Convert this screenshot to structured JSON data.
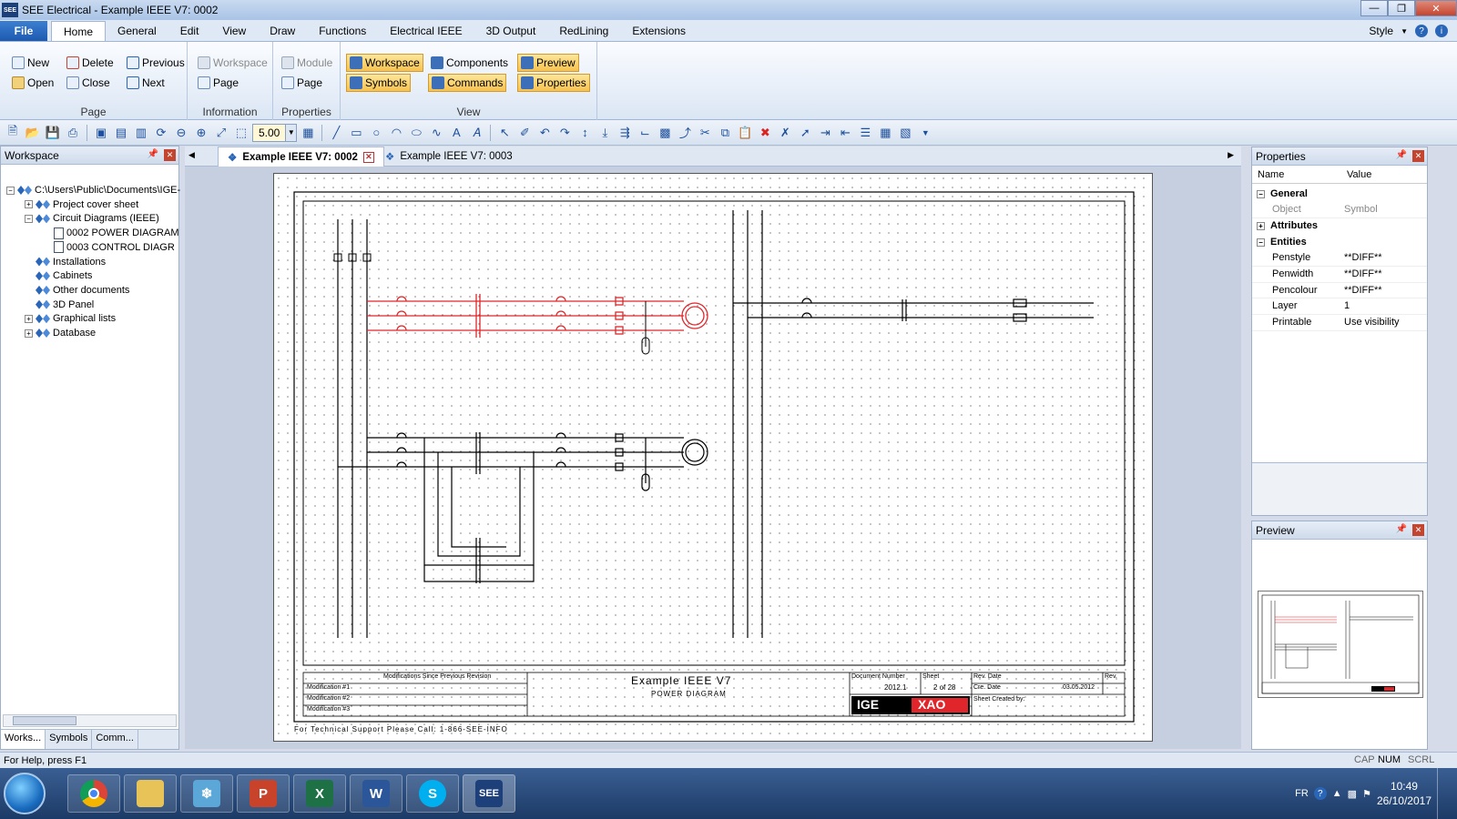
{
  "window": {
    "title": "SEE Electrical - Example IEEE V7: 0002",
    "app_icon": "SEE"
  },
  "menu": {
    "file": "File",
    "tabs": [
      "Home",
      "General",
      "Edit",
      "View",
      "Draw",
      "Functions",
      "Electrical IEEE",
      "3D Output",
      "RedLining",
      "Extensions"
    ],
    "active_tab": "Home",
    "style_label": "Style"
  },
  "ribbon": {
    "groups": {
      "page": {
        "label": "Page",
        "new": "New",
        "open": "Open",
        "delete": "Delete",
        "close": "Close",
        "previous": "Previous",
        "next": "Next"
      },
      "information": {
        "label": "Information",
        "workspace": "Workspace",
        "page": "Page"
      },
      "properties": {
        "label": "Properties",
        "module": "Module",
        "page": "Page"
      },
      "view": {
        "label": "View",
        "workspace": "Workspace",
        "symbols": "Symbols",
        "components": "Components",
        "commands": "Commands",
        "preview": "Preview",
        "properties": "Properties"
      }
    }
  },
  "toolbar": {
    "zoom_value": "5.00"
  },
  "workspace": {
    "title": "Workspace",
    "tree": [
      {
        "label": "C:\\Users\\Public\\Documents\\IGE-",
        "level": 0,
        "expander": "−"
      },
      {
        "label": "Project cover sheet",
        "level": 1,
        "expander": "+"
      },
      {
        "label": "Circuit Diagrams (IEEE)",
        "level": 1,
        "expander": "−"
      },
      {
        "label": "0002 POWER DIAGRAM",
        "level": 2,
        "expander": ""
      },
      {
        "label": "0003 CONTROL DIAGR",
        "level": 2,
        "expander": ""
      },
      {
        "label": "Installations",
        "level": 1,
        "expander": ""
      },
      {
        "label": "Cabinets",
        "level": 1,
        "expander": ""
      },
      {
        "label": "Other documents",
        "level": 1,
        "expander": ""
      },
      {
        "label": "3D Panel",
        "level": 1,
        "expander": ""
      },
      {
        "label": "Graphical lists",
        "level": 1,
        "expander": "+"
      },
      {
        "label": "Database",
        "level": 1,
        "expander": "+"
      }
    ],
    "bottom_tabs": [
      "Works...",
      "Symbols",
      "Comm..."
    ]
  },
  "doc_tabs": [
    {
      "label": "Example IEEE V7: 0002",
      "active": true
    },
    {
      "label": "Example IEEE V7: 0003",
      "active": false
    }
  ],
  "drawing": {
    "title": "Example IEEE V7",
    "subtitle": "POWER DIAGRAM",
    "doc_number_label": "Document Number",
    "doc_number": "2012.1",
    "sheet_label": "Sheet",
    "sheet": "2 of 28",
    "rev_date_label": "Rev. Date",
    "cre_date_label": "Cre. Date",
    "cre_date": "03.05.2012",
    "created_by": "Sheet Created by:",
    "rev": "Rev.",
    "mod_header": "Modifications Since Previous Revision",
    "mods": [
      "Modification #1",
      "Modification #2",
      "Modification #3"
    ],
    "support": "For Technical Support Please Call: 1-866-SEE-INFO",
    "logo_left": "IGE",
    "logo_right": "XAO"
  },
  "properties": {
    "title": "Properties",
    "col_name": "Name",
    "col_value": "Value",
    "rows": [
      {
        "name": "General",
        "value": "",
        "section": true,
        "tog": "−"
      },
      {
        "name": "Object",
        "value": "Symbol",
        "section": false,
        "dim": true
      },
      {
        "name": "Attributes",
        "value": "",
        "section": true,
        "tog": "+"
      },
      {
        "name": "Entities",
        "value": "",
        "section": true,
        "tog": "−"
      },
      {
        "name": "Penstyle",
        "value": "**DIFF**",
        "section": false
      },
      {
        "name": "Penwidth",
        "value": "**DIFF**",
        "section": false
      },
      {
        "name": "Pencolour",
        "value": "**DIFF**",
        "section": false
      },
      {
        "name": "Layer",
        "value": "1",
        "section": false
      },
      {
        "name": "Printable",
        "value": "Use visibility",
        "section": false
      }
    ]
  },
  "preview": {
    "title": "Preview"
  },
  "status": {
    "help": "For Help, press F1",
    "cap": "CAP",
    "num": "NUM",
    "scrl": "SCRL"
  },
  "taskbar": {
    "lang": "FR",
    "time": "10:49",
    "date": "26/10/2017",
    "apps": [
      "chrome",
      "explorer",
      "network",
      "powerpoint",
      "excel",
      "word",
      "skype",
      "see-electrical"
    ]
  }
}
